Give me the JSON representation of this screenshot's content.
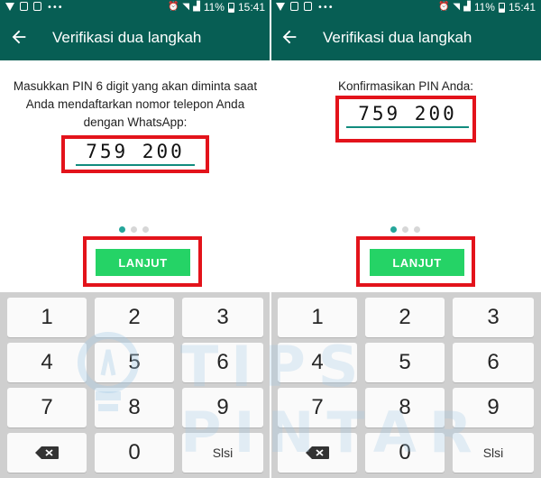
{
  "status_bar": {
    "battery": "11%",
    "time": "15:41",
    "icons": [
      "download-icon",
      "picture-icon",
      "file-icon",
      "dots-icon",
      "alarm-icon",
      "wifi-icon",
      "signal-icon",
      "battery-icon"
    ]
  },
  "app_bar": {
    "title": "Verifikasi dua langkah",
    "back_icon": "arrow-left-icon"
  },
  "screen1": {
    "instruction": "Masukkan PIN 6 digit yang akan diminta saat Anda mendaftarkan nomor telepon Anda dengan WhatsApp:",
    "pin_value": "759 200",
    "button_label": "LANJUT",
    "page_indicator": {
      "total": 3,
      "active": 1
    }
  },
  "screen2": {
    "instruction": "Konfirmasikan PIN Anda:",
    "pin_value": "759 200",
    "button_label": "LANJUT",
    "page_indicator": {
      "total": 3,
      "active": 1
    }
  },
  "keyboard": {
    "keys": [
      "1",
      "2",
      "3",
      "4",
      "5",
      "6",
      "7",
      "8",
      "9",
      "0"
    ],
    "backspace_icon": "backspace-icon",
    "next_label": "Slsi"
  },
  "watermark": {
    "text": "TIPS PINTAR"
  },
  "colors": {
    "app_bar": "#075E54",
    "accent": "#25D366",
    "pin_underline": "#128C7E",
    "highlight": "#e3131b",
    "keyboard_bg": "#cfcfcf"
  }
}
